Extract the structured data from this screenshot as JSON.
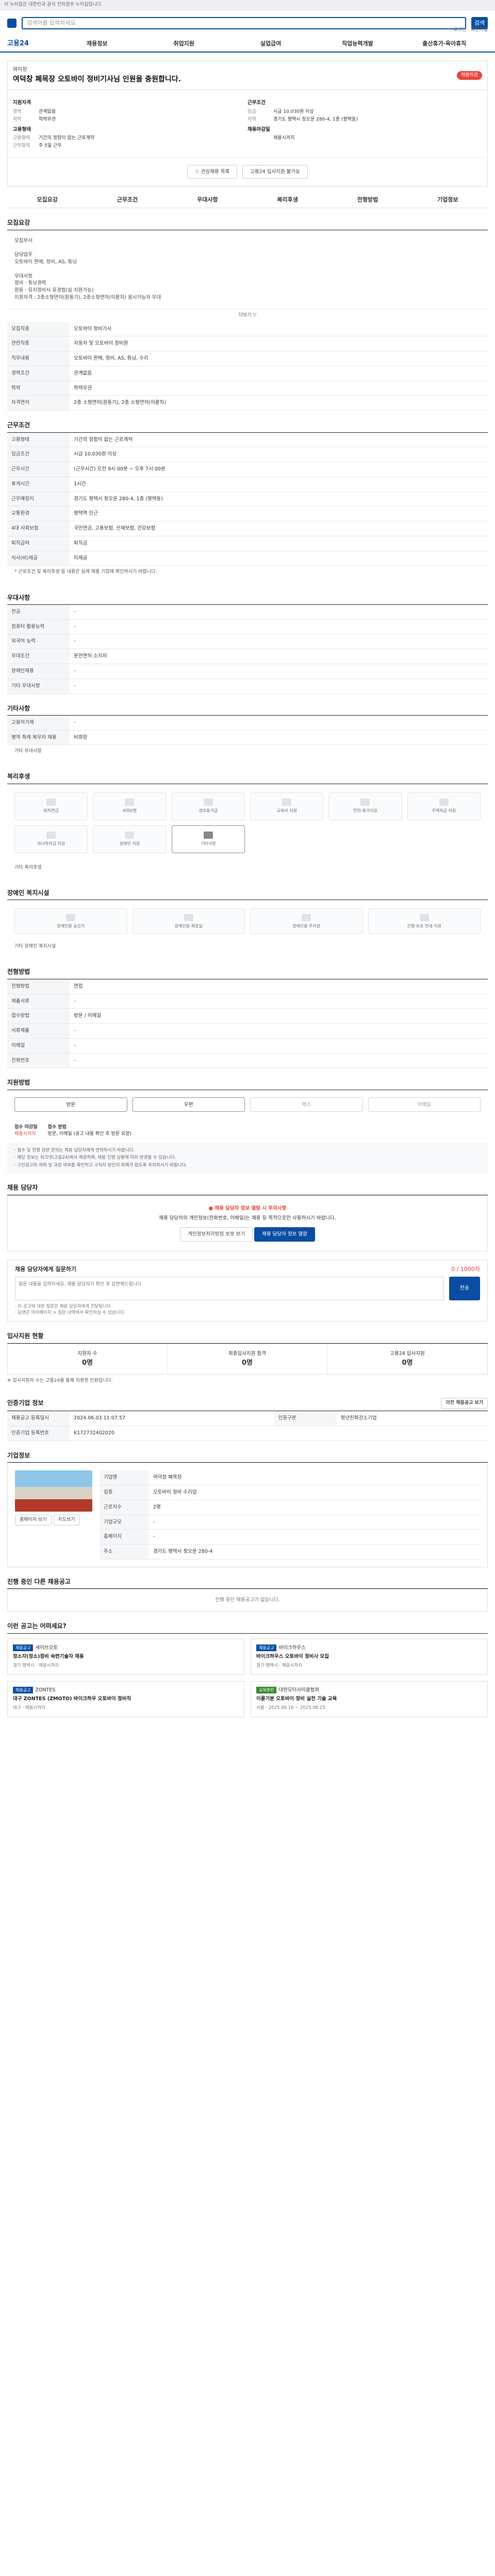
{
  "topbar": {
    "text": "이 누리집은 대한민국 공식 전자정부 누리집입니다."
  },
  "search": {
    "placeholder": "검색어를 입력하세요",
    "btn": "검색"
  },
  "utils": {
    "text": "로그인 · 회원가입"
  },
  "gnb": {
    "brand": "고용24",
    "items": [
      "채용정보",
      "취업지원",
      "실업급여",
      "직업능력개발",
      "출산휴가·육아휴직"
    ]
  },
  "header": {
    "company": "여덕창",
    "title": "여덕창 폐목장 오토바이 정비기사님 인원을 충원합니다.",
    "badge": "채용마감"
  },
  "summary": {
    "left": {
      "h1": "지원자격",
      "rows": [
        [
          "경력",
          "관계없음"
        ],
        [
          "학력",
          "학력무관"
        ]
      ],
      "h2": "고용형태",
      "rows2": [
        [
          "고용형태",
          "기간의 정함이 없는 근로계약"
        ],
        [
          "근무형태",
          "주 5일 근무"
        ]
      ]
    },
    "right": {
      "h1": "근무조건",
      "rows": [
        [
          "임금",
          "시급 10,030원 이상"
        ],
        [
          "지역",
          "경기도 평택시 청오문 280-4, 1층 (평택동)"
        ]
      ],
      "h2": "채용마감일",
      "rows2": [
        [
          "",
          "채용시까지"
        ]
      ]
    }
  },
  "actions": {
    "a1": "관심채용 목록",
    "a2": "고용24 입사지원 불가능"
  },
  "tabs": [
    "모집요강",
    "근무조건",
    "우대사항",
    "복리후생",
    "전형방법",
    "기업정보"
  ],
  "job": {
    "title": "모집요강",
    "desc": "모집부서\n\n담당업무\n오토바이 판매, 정비, AS, 튜닝\n\n우대사항\n정비 · 튜닝경력\n원동 · 유지정비사 유경험(실 지원가능)\n지원자격 : 2종소형면허(원동기), 2종소형면허(이륜차) 응시가능자 우대",
    "more": "더보기 ▽"
  },
  "jobtable": [
    [
      "모집직종",
      "오토바이 정비기사"
    ],
    [
      "관련직종",
      "자동차 및 오토바이 정비원"
    ],
    [
      "직무내용",
      "오토바이 판매, 정비, AS, 튜닝, 수리"
    ],
    [
      "경력조건",
      "관계없음"
    ],
    [
      "학력",
      "학력무관"
    ],
    [
      "자격면허",
      "2종 소형면허(원동기), 2종 소형면허(이륜차)"
    ]
  ],
  "worktitle": "근무조건",
  "work": [
    [
      "고용형태",
      "기간의 정함이 없는 근로계약"
    ],
    [
      "임금조건",
      "시급 10,030원 이상"
    ],
    [
      "근무시간",
      "(근무시간) 오전 9시 00분 ~ 오후 7시 00분"
    ],
    [
      "휴게시간",
      "1시간"
    ],
    [
      "근무예정지",
      "경기도 평택시 청오문 280-4, 1층 (평택동)"
    ],
    [
      "교통환경",
      "평택역 인근"
    ],
    [
      "4대 사회보험",
      "국민연금, 고용보험, 산재보험, 건강보험"
    ],
    [
      "퇴직급여",
      "퇴직금"
    ],
    [
      "식사(비)제공",
      "미제공"
    ]
  ],
  "worknote": "* 근로조건 및 복리후생 등 내용은 실제 채용 기업에 확인하시기 바랍니다.",
  "preftitle": "우대사항",
  "pref": [
    [
      "전공",
      "-"
    ],
    [
      "컴퓨터 활용능력",
      "-"
    ],
    [
      "외국어 능력",
      "-"
    ],
    [
      "우대조건",
      "운전면허 소지자"
    ],
    [
      "장애인채용",
      "-"
    ],
    [
      "기타 우대사항",
      "-"
    ]
  ],
  "othertitle": "기타사항",
  "other": [
    [
      "고용허가제",
      "-"
    ],
    [
      "병역 특례 복무자 채용",
      "비희망"
    ]
  ],
  "othernote": "기타 우대사항",
  "benefittitle": "복리후생",
  "benefits": [
    "퇴직연금",
    "4대보험",
    "경조휴가금",
    "교육비 지원",
    "연차·휴가지원",
    "주택자금 지원",
    "자녀학자금 지원",
    "장애인 지원",
    "기타사항"
  ],
  "benefit_on_index": 8,
  "benefitnote": "기타 복리후생",
  "disabledtitle": "장애인 복지시설",
  "disabled": [
    "장애인용 승강기",
    "장애인용 화장실",
    "장애인용 주차장",
    "간병·보조 안내 지원"
  ],
  "disablednote": "기타 장애인 복지시설",
  "selecttitle": "전형방법",
  "select": [
    [
      "전형방법",
      "면접"
    ],
    [
      "제출서류",
      "-"
    ],
    [
      "접수방법",
      "방문 / 이메일"
    ],
    [
      "서류제출",
      "-"
    ],
    [
      "이메일",
      "-"
    ],
    [
      "전화번호",
      "-"
    ]
  ],
  "methodtitle": "지원방법",
  "methods": [
    "방문",
    "우편",
    "팩스",
    "이메일"
  ],
  "method_on": [
    0,
    1
  ],
  "applyinfo": {
    "label": "접수 마감일",
    "value": "채용시까지",
    "label2": "접수 방법",
    "value2": "방문, 이메일 (공고 내용 확인 후 방문 요망)"
  },
  "bullets": [
    "· 접수 및 전형 관련 문의는 채용 담당자에게 연락하시기 바랍니다.",
    "· 해당 정보는 워크넷(고용24)에서 제공하며, 채용 진행 상황에 따라 변경될 수 있습니다.",
    "· 구인광고의 허위 및 과장 여부를 확인하고 구직자 본인의 피해가 없도록 주의하시기 바랍니다."
  ],
  "mgrtitle": "채용 담당자",
  "mgr": {
    "warn": "● 채용 담당자 정보 열람 시 주의사항",
    "text": "채용 담당자의 개인정보(전화번호, 이메일)는 채용 등 목적으로만 사용하시기 바랍니다.",
    "btn1": "개인정보처리방침 보호 보기",
    "btn2": "채용 담당자 정보 열람"
  },
  "qa": {
    "title": "채용 담당자에게 질문하기",
    "hint": "0 / 1000자",
    "placeholder": "질문 내용을 입력하세요. 채용 담당자가 확인 후 답변해드립니다.",
    "send": "전송",
    "notes": [
      "· 이 공고에 대한 질문은 채용 담당자에게 전달됩니다.",
      "· 답변은 마이페이지 > 질문 내역에서 확인하실 수 있습니다."
    ]
  },
  "statstitle": "입사지원 현황",
  "stats": [
    [
      "지원자 수",
      "0명"
    ],
    [
      "최종입사지원 합격",
      "0명"
    ],
    [
      "고용24 입사지원",
      "0명"
    ]
  ],
  "statsnote": "※ 입사지원자 수는 고용24를 통해 지원한 인원입니다.",
  "infotitle": "인증기업 정보",
  "info": [
    [
      "채용공고 등록일시",
      "2024.06.03 11:07:57"
    ],
    [
      "인증구분",
      "청년친화강소기업"
    ],
    [
      "인증기업 등록번호",
      "K172732402020"
    ]
  ],
  "info_btn": "이전 채용공고 보기",
  "corptitle": "기업정보",
  "corp": [
    [
      "기업명",
      "여덕창 폐목장"
    ],
    [
      "업종",
      "오토바이 정비 수리업"
    ],
    [
      "근로자수",
      "2명"
    ],
    [
      "기업규모",
      "-"
    ],
    [
      "홈페이지",
      "-"
    ],
    [
      "주소",
      "경기도 평택시 청오문 280-4"
    ]
  ],
  "corp_btn1": "홈페이지 보기",
  "corp_btn2": "지도보기",
  "endedtitle": "진행 중인 다른 채용공고",
  "ended": "진행 중인 채용공고가 없습니다.",
  "reltitle": "이런 공고는 어떠세요?",
  "rel": [
    {
      "badge": "채용공고",
      "company": "세이브오토",
      "title": "정소자(정소)정비 숙련기술자 채용",
      "meta": "경기 평택시 · 채용시까지"
    },
    {
      "badge": "채용공고",
      "company": "바이크하우스",
      "title": "바이크하우스 오토바이 정비사 모집",
      "meta": "경기 평택시 · 채용시까지"
    },
    {
      "badge": "채용공고",
      "company": "ZONTES",
      "title": "대구 ZONTES (ZMOTO) 바이크하우 오토바이 정비직",
      "meta": "대구 · 채용시까지"
    },
    {
      "badge": "교육훈련",
      "company": "대한모터사이클협회",
      "title": "이륜기분 오토바이 정비 실전 기술 교육",
      "meta": "서울 · 2025.06.16 ~ 2025.08.25"
    }
  ]
}
